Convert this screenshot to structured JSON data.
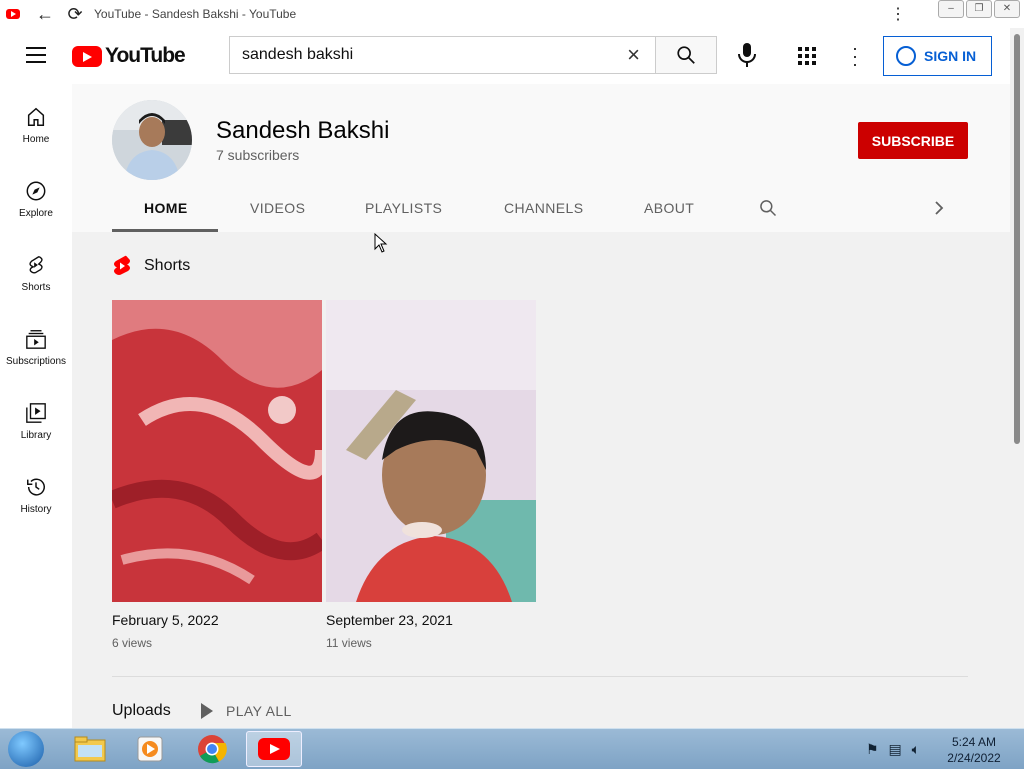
{
  "browser": {
    "tab_title": "YouTube - Sandesh Bakshi - YouTube",
    "window_buttons": [
      "–",
      "❐",
      "✕"
    ]
  },
  "masthead": {
    "logo_text": "YouTube",
    "search_value": "sandesh bakshi",
    "sign_in": "SIGN IN"
  },
  "guide": {
    "items": [
      {
        "label": "Home",
        "icon": "home-icon"
      },
      {
        "label": "Explore",
        "icon": "compass-icon"
      },
      {
        "label": "Shorts",
        "icon": "shorts-icon"
      },
      {
        "label": "Subscriptions",
        "icon": "subscriptions-icon"
      },
      {
        "label": "Library",
        "icon": "library-icon"
      },
      {
        "label": "History",
        "icon": "history-icon"
      }
    ]
  },
  "channel": {
    "name": "Sandesh Bakshi",
    "subscribers": "7 subscribers",
    "subscribe_label": "SUBSCRIBE",
    "tabs": [
      "HOME",
      "VIDEOS",
      "PLAYLISTS",
      "CHANNELS",
      "ABOUT"
    ],
    "active_tab": "HOME"
  },
  "shorts": {
    "heading": "Shorts",
    "videos": [
      {
        "date": "February 5, 2022",
        "views": "6 views"
      },
      {
        "date": "September 23, 2021",
        "views": "11 views"
      }
    ]
  },
  "uploads": {
    "heading": "Uploads",
    "play_all": "PLAY ALL"
  },
  "taskbar": {
    "time": "5:24 AM",
    "date": "2/24/2022"
  },
  "colors": {
    "brand_red": "#ff0000",
    "subscribe_red": "#cc0000",
    "link_blue": "#065fd4"
  }
}
